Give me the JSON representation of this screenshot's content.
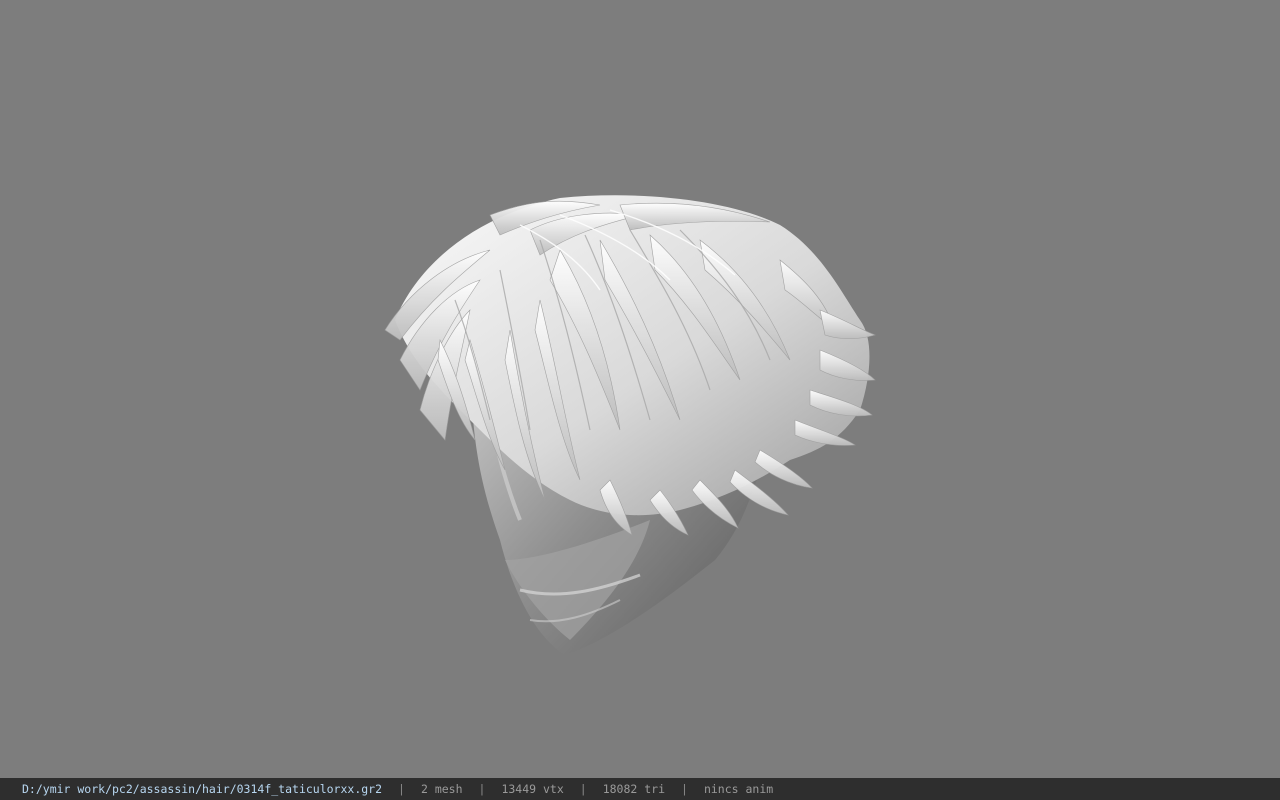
{
  "viewport": {
    "background_color": "#7d7d7d",
    "model_color": "#e6e6e6",
    "model_name": "hair-model"
  },
  "status": {
    "file_path": "D:/ymir work/pc2/assassin/hair/0314f_taticulorxx.gr2",
    "separator": "|",
    "mesh": "2 mesh",
    "vertices": "13449 vtx",
    "triangles": "18082 tri",
    "anim": "nincs anim",
    "bar_color": "#2e2e2e",
    "path_color": "#b7d6f0"
  }
}
